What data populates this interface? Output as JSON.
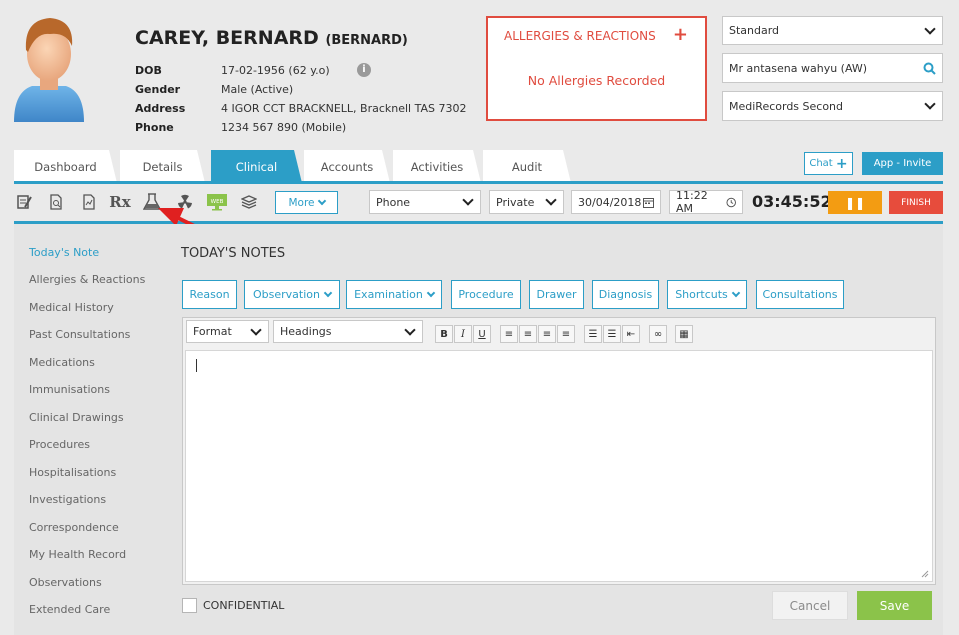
{
  "patient": {
    "name": "CAREY, BERNARD",
    "preferred": "(BERNARD)",
    "fields": [
      {
        "label": "DOB",
        "value": "17-02-1956 (62 y.o)"
      },
      {
        "label": "Gender",
        "value": "Male (Active)"
      },
      {
        "label": "Address",
        "value": "4 IGOR CCT BRACKNELL, Bracknell TAS 7302"
      },
      {
        "label": "Phone",
        "value": "1234 567 890 (Mobile)"
      }
    ],
    "info_icon": "i"
  },
  "allergies": {
    "title": "ALLERGIES & REACTIONS",
    "add": "+",
    "message": "No Allergies Recorded"
  },
  "right_panel": {
    "billing_type": "Standard",
    "practitioner": "Mr antasena wahyu (AW)",
    "location": "MediRecords Second"
  },
  "tabs": [
    "Dashboard",
    "Details",
    "Clinical",
    "Accounts",
    "Activities",
    "Audit"
  ],
  "active_tab": "Clinical",
  "header_buttons": {
    "chat": "Chat",
    "chat_plus": "+",
    "app_invite": "App - Invite"
  },
  "toolbar": {
    "icons": [
      "notes-icon",
      "document-search-icon",
      "report-icon",
      "prescription-icon",
      "lab-flask-icon",
      "radiation-icon",
      "monitor-web-icon",
      "layers-icon"
    ],
    "rx_text": "Rx",
    "web_text": "WEB",
    "more": "More",
    "contact_type": "Phone",
    "billing": "Private",
    "date": "30/04/2018",
    "time": "11:22 AM",
    "timer": "03:45:52",
    "pause": "❚❚",
    "finish": "FINISH"
  },
  "sidebar": {
    "items": [
      "Today's Note",
      "Allergies & Reactions",
      "Medical History",
      "Past Consultations",
      "Medications",
      "Immunisations",
      "Clinical Drawings",
      "Procedures",
      "Hospitalisations",
      "Investigations",
      "Correspondence",
      "My Health Record",
      "Observations",
      "Extended Care"
    ],
    "active": "Today's Note"
  },
  "notes": {
    "title": "TODAY'S NOTES",
    "section_buttons": [
      "Reason",
      "Observation",
      "Examination",
      "Procedure",
      "Drawer",
      "Diagnosis",
      "Shortcuts",
      "Consultations"
    ],
    "format": "Format",
    "headings": "Headings",
    "editor_tools": [
      "B",
      "I",
      "U",
      "≡",
      "≡",
      "≡",
      "≡",
      "☰",
      "☰",
      "⇤",
      "∞",
      "▦"
    ],
    "confidential": "CONFIDENTIAL",
    "cancel": "Cancel",
    "save": "Save"
  },
  "colors": {
    "accent": "#2c9ec7",
    "alert": "#e04c3f",
    "pause": "#f39c12",
    "finish": "#e74c3c",
    "save": "#8bc34a"
  }
}
